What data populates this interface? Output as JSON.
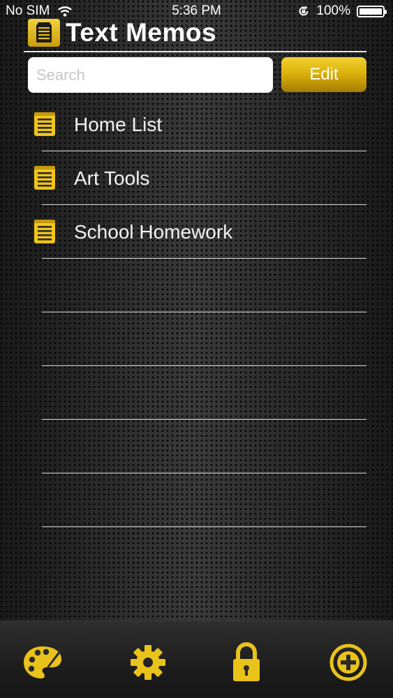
{
  "status_bar": {
    "carrier": "No SIM",
    "time": "5:36 PM",
    "battery": "100%",
    "battery_level": 1.0
  },
  "header": {
    "title": "Text Memos",
    "icon": "notepad-icon"
  },
  "search": {
    "placeholder": "Search",
    "value": ""
  },
  "edit_label": "Edit",
  "memos": [
    {
      "label": "Home List"
    },
    {
      "label": "Art Tools"
    },
    {
      "label": "School Homework"
    },
    {
      "label": ""
    },
    {
      "label": ""
    },
    {
      "label": ""
    },
    {
      "label": ""
    },
    {
      "label": ""
    }
  ],
  "tabs": [
    {
      "name": "palette",
      "icon": "palette-icon"
    },
    {
      "name": "settings",
      "icon": "gear-icon"
    },
    {
      "name": "lock",
      "icon": "lock-icon"
    },
    {
      "name": "add",
      "icon": "plus-circle-icon"
    }
  ],
  "colors": {
    "accent": "#e9c21a",
    "accent_dark": "#a57e05",
    "background": "#1f1f1f"
  }
}
